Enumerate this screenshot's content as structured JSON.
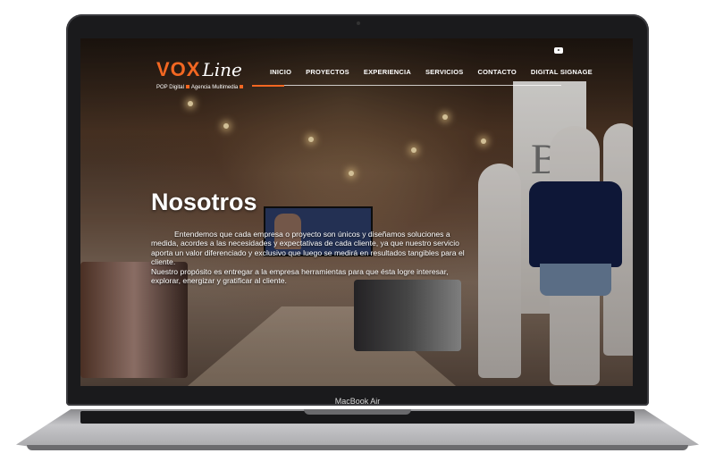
{
  "device": {
    "label": "MacBook Air"
  },
  "site": {
    "logo": {
      "wordmark_left": "VOX",
      "wordmark_right": "Line",
      "tagline_1": "POP Digital",
      "tagline_2": "Agencia Multimedia"
    },
    "nav": {
      "items": [
        "INICIO",
        "PROYECTOS",
        "EXPERIENCIA",
        "SERVICIOS",
        "CONTACTO",
        "DIGITAL SIGNAGE"
      ],
      "active": "INICIO"
    },
    "social": {
      "icon": "youtube-icon"
    },
    "hero": {
      "title": "Nosotros",
      "paragraph_1": "Entendemos que cada empresa o proyecto son únicos y diseñamos soluciones a medida, acordes a las necesidades y expectativas de cada cliente, ya que nuestro servicio aporta un valor diferenciado y exclusivo que luego se medirá en resultados tangibles para el cliente.",
      "paragraph_2": "Nuestro propósito es entregar a la empresa herramientas para que ésta logre interesar, explorar, energizar y gratificar al cliente."
    }
  },
  "colors": {
    "accent": "#f26722",
    "text": "#ffffff",
    "frame": "#1a1a1c"
  }
}
